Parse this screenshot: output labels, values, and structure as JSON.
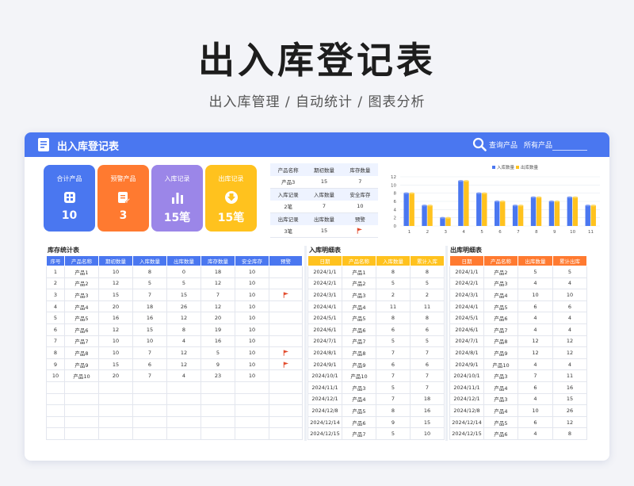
{
  "hero": {
    "title": "出入库登记表",
    "subtitle": "出入库管理 / 自动统计 / 图表分析"
  },
  "topbar": {
    "title": "出入库登记表",
    "search_label": "查询产品",
    "filter_label": "所有产品",
    "bg_color": "#4a77f0",
    "icons": [
      "document-icon",
      "search-icon"
    ]
  },
  "tiles": [
    {
      "label": "合计产品",
      "value": "10",
      "icon": "grid-icon",
      "color": "#4a77f0"
    },
    {
      "label": "预警产品",
      "value": "3",
      "icon": "edit-icon",
      "color": "#ff7a30"
    },
    {
      "label": "入库记录",
      "value": "15笔",
      "icon": "bar-chart-icon",
      "color": "#9b86e8"
    },
    {
      "label": "出库记录",
      "value": "15笔",
      "icon": "download-icon",
      "color": "#ffc21e"
    }
  ],
  "summary": {
    "row1_headers": [
      "产品名称",
      "期初数量",
      "库存数量"
    ],
    "row1_values": [
      "产品3",
      "15",
      "7"
    ],
    "row2_headers": [
      "入库记录",
      "入库数量",
      "安全库存"
    ],
    "row2_values": [
      "2笔",
      "7",
      "10"
    ],
    "row3_headers": [
      "出库记录",
      "出库数量",
      "预警"
    ],
    "row3_values": [
      "3笔",
      "15",
      ""
    ]
  },
  "chart_data": {
    "type": "bar",
    "categories": [
      "1",
      "2",
      "3",
      "4",
      "5",
      "6",
      "7",
      "8",
      "9",
      "10",
      "11"
    ],
    "series": [
      {
        "name": "入库数量",
        "color": "#4a77f0",
        "values": [
          8,
          5,
          2,
          11,
          8,
          6,
          5,
          7,
          6,
          7,
          5
        ]
      },
      {
        "name": "出库数量",
        "color": "#ffc21e",
        "values": [
          8,
          5,
          2,
          11,
          8,
          6,
          5,
          7,
          6,
          7,
          5
        ]
      }
    ],
    "ylim": [
      0,
      12
    ],
    "yticks": [
      0,
      2,
      4,
      6,
      8,
      10,
      12
    ],
    "grid": true,
    "legend": "top-center"
  },
  "inventory": {
    "title": "库存统计表",
    "header_color": "#4a77f0",
    "headers": [
      "序号",
      "产品名称",
      "期初数量",
      "入库数量",
      "出库数量",
      "库存数量",
      "安全库存",
      "预警"
    ],
    "rows": [
      [
        "1",
        "产品1",
        "10",
        "8",
        "0",
        "18",
        "10",
        ""
      ],
      [
        "2",
        "产品2",
        "12",
        "5",
        "5",
        "12",
        "10",
        ""
      ],
      [
        "3",
        "产品3",
        "15",
        "7",
        "15",
        "7",
        "10",
        "flag"
      ],
      [
        "4",
        "产品4",
        "20",
        "18",
        "26",
        "12",
        "10",
        ""
      ],
      [
        "5",
        "产品5",
        "16",
        "16",
        "12",
        "20",
        "10",
        ""
      ],
      [
        "6",
        "产品6",
        "12",
        "15",
        "8",
        "19",
        "10",
        ""
      ],
      [
        "7",
        "产品7",
        "10",
        "10",
        "4",
        "16",
        "10",
        ""
      ],
      [
        "8",
        "产品8",
        "10",
        "7",
        "12",
        "5",
        "10",
        "flag"
      ],
      [
        "9",
        "产品9",
        "15",
        "6",
        "12",
        "9",
        "10",
        "flag"
      ],
      [
        "10",
        "产品10",
        "20",
        "7",
        "4",
        "23",
        "10",
        ""
      ],
      [
        "",
        "",
        "",
        "",
        "",
        "",
        "",
        ""
      ],
      [
        "",
        "",
        "",
        "",
        "",
        "",
        "",
        ""
      ],
      [
        "",
        "",
        "",
        "",
        "",
        "",
        "",
        ""
      ],
      [
        "",
        "",
        "",
        "",
        "",
        "",
        "",
        ""
      ],
      [
        "",
        "",
        "",
        "",
        "",
        "",
        "",
        ""
      ]
    ]
  },
  "inbound": {
    "title": "入库明细表",
    "header_color": "#ffc21e",
    "headers": [
      "日期",
      "产品名称",
      "入库数量",
      "累计入库"
    ],
    "rows": [
      [
        "2024/1/1",
        "产品1",
        "8",
        "8"
      ],
      [
        "2024/2/1",
        "产品2",
        "5",
        "5"
      ],
      [
        "2024/3/1",
        "产品3",
        "2",
        "2"
      ],
      [
        "2024/4/1",
        "产品4",
        "11",
        "11"
      ],
      [
        "2024/5/1",
        "产品5",
        "8",
        "8"
      ],
      [
        "2024/6/1",
        "产品6",
        "6",
        "6"
      ],
      [
        "2024/7/1",
        "产品7",
        "5",
        "5"
      ],
      [
        "2024/8/1",
        "产品8",
        "7",
        "7"
      ],
      [
        "2024/9/1",
        "产品9",
        "6",
        "6"
      ],
      [
        "2024/10/1",
        "产品10",
        "7",
        "7"
      ],
      [
        "2024/11/1",
        "产品3",
        "5",
        "7"
      ],
      [
        "2024/12/1",
        "产品4",
        "7",
        "18"
      ],
      [
        "2024/12/8",
        "产品5",
        "8",
        "16"
      ],
      [
        "2024/12/14",
        "产品6",
        "9",
        "15"
      ],
      [
        "2024/12/15",
        "产品7",
        "5",
        "10"
      ]
    ]
  },
  "outbound": {
    "title": "出库明细表",
    "header_color": "#ff7a30",
    "headers": [
      "日期",
      "产品名称",
      "出库数量",
      "累计出库"
    ],
    "rows": [
      [
        "2024/1/1",
        "产品2",
        "5",
        "5"
      ],
      [
        "2024/2/1",
        "产品3",
        "4",
        "4"
      ],
      [
        "2024/3/1",
        "产品4",
        "10",
        "10"
      ],
      [
        "2024/4/1",
        "产品5",
        "6",
        "6"
      ],
      [
        "2024/5/1",
        "产品6",
        "4",
        "4"
      ],
      [
        "2024/6/1",
        "产品7",
        "4",
        "4"
      ],
      [
        "2024/7/1",
        "产品8",
        "12",
        "12"
      ],
      [
        "2024/8/1",
        "产品9",
        "12",
        "12"
      ],
      [
        "2024/9/1",
        "产品10",
        "4",
        "4"
      ],
      [
        "2024/10/1",
        "产品3",
        "7",
        "11"
      ],
      [
        "2024/11/1",
        "产品4",
        "6",
        "16"
      ],
      [
        "2024/12/1",
        "产品3",
        "4",
        "15"
      ],
      [
        "2024/12/8",
        "产品4",
        "10",
        "26"
      ],
      [
        "2024/12/14",
        "产品5",
        "6",
        "12"
      ],
      [
        "2024/12/15",
        "产品6",
        "4",
        "8"
      ]
    ]
  }
}
